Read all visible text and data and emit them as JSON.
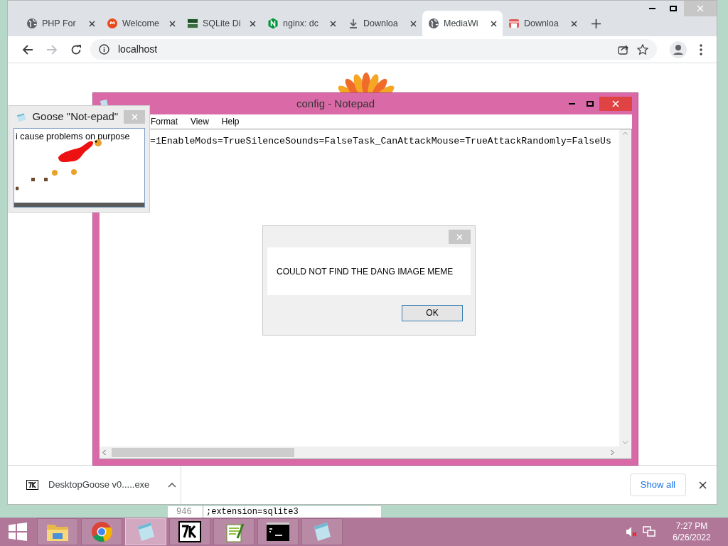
{
  "browser": {
    "tabs": [
      {
        "label": "PHP For",
        "kind": "globe",
        "selected": false
      },
      {
        "label": "Welcome",
        "kind": "redcircle",
        "selected": false
      },
      {
        "label": "SQLite Di",
        "kind": "sqlite",
        "selected": false
      },
      {
        "label": "nginx: dc",
        "kind": "nginx",
        "selected": false
      },
      {
        "label": "Downloa",
        "kind": "download",
        "selected": false
      },
      {
        "label": "MediaWi",
        "kind": "globe",
        "selected": true
      },
      {
        "label": "Downloa",
        "kind": "store",
        "selected": false
      }
    ],
    "address": "localhost",
    "download_bar": {
      "file": "DesktopGoose v0.....exe",
      "button": "Show all"
    }
  },
  "background_editor": {
    "line_number": "946",
    "text": ";extension=sqlite3"
  },
  "notepad": {
    "title": "config - Notepad",
    "menu": [
      "Format",
      "View",
      "Help"
    ],
    "text": "=1EnableMods=TrueSilenceSounds=FalseTask_CanAttackMouse=TrueAttackRandomly=FalseUs"
  },
  "goose_window": {
    "title": "Goose \"Not-epad\"",
    "text": "i cause problems on purpose"
  },
  "dialog": {
    "message": "COULD NOT FIND THE DANG IMAGE MEME",
    "button": "OK"
  },
  "taskbar": {
    "apps": [
      {
        "kind": "explorer",
        "selected": false
      },
      {
        "kind": "chrome",
        "selected": false
      },
      {
        "kind": "notepad",
        "selected": true
      },
      {
        "kind": "sevenzip",
        "selected": false
      },
      {
        "kind": "notepadpp",
        "selected": false
      },
      {
        "kind": "cmd",
        "selected": false
      },
      {
        "kind": "notepad",
        "selected": false
      }
    ],
    "time": "7:27 PM",
    "date": "6/26/2022"
  }
}
